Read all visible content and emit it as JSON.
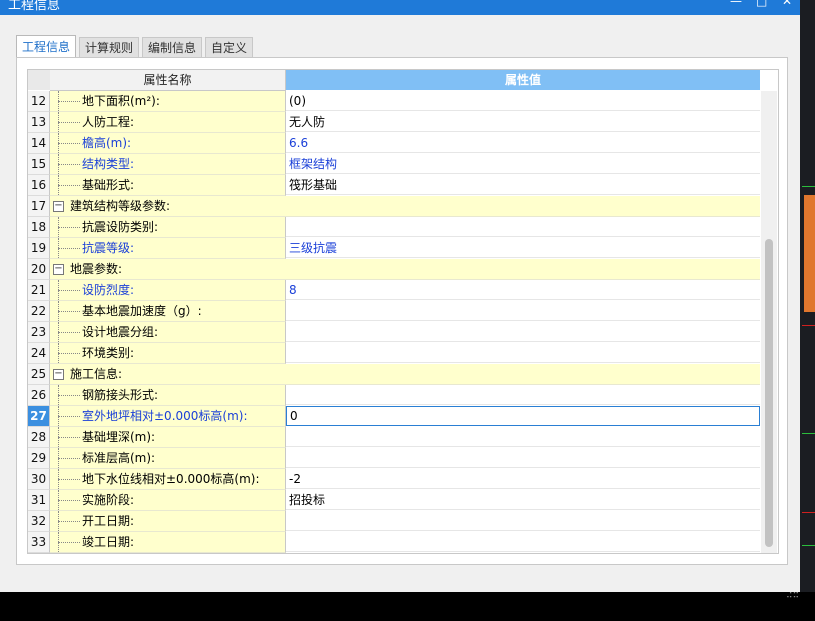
{
  "window": {
    "title": "工程信息",
    "minimize": "—",
    "maximize": "□",
    "close": "✕"
  },
  "tabs": [
    {
      "label": "工程信息",
      "active": true
    },
    {
      "label": "计算规则",
      "active": false
    },
    {
      "label": "编制信息",
      "active": false
    },
    {
      "label": "自定义",
      "active": false
    }
  ],
  "grid": {
    "headers": {
      "name": "属性名称",
      "value": "属性值"
    },
    "selected_row": "27",
    "rows": [
      {
        "num": "12",
        "name": "地下面积(m²):",
        "value": "(0)",
        "blue": false,
        "group": false
      },
      {
        "num": "13",
        "name": "人防工程:",
        "value": "无人防",
        "blue": false,
        "group": false
      },
      {
        "num": "14",
        "name": "檐高(m):",
        "value": "6.6",
        "blue": true,
        "group": false
      },
      {
        "num": "15",
        "name": "结构类型:",
        "value": "框架结构",
        "blue": true,
        "group": false
      },
      {
        "num": "16",
        "name": "基础形式:",
        "value": "筏形基础",
        "blue": false,
        "group": false
      },
      {
        "num": "17",
        "name": "建筑结构等级参数:",
        "value": "",
        "blue": false,
        "group": true
      },
      {
        "num": "18",
        "name": "抗震设防类别:",
        "value": "",
        "blue": false,
        "group": false
      },
      {
        "num": "19",
        "name": "抗震等级:",
        "value": "三级抗震",
        "blue": true,
        "group": false
      },
      {
        "num": "20",
        "name": "地震参数:",
        "value": "",
        "blue": false,
        "group": true
      },
      {
        "num": "21",
        "name": "设防烈度:",
        "value": "8",
        "blue": true,
        "group": false
      },
      {
        "num": "22",
        "name": "基本地震加速度（g）:",
        "value": "",
        "blue": false,
        "group": false
      },
      {
        "num": "23",
        "name": "设计地震分组:",
        "value": "",
        "blue": false,
        "group": false
      },
      {
        "num": "24",
        "name": "环境类别:",
        "value": "",
        "blue": false,
        "group": false
      },
      {
        "num": "25",
        "name": "施工信息:",
        "value": "",
        "blue": false,
        "group": true
      },
      {
        "num": "26",
        "name": "钢筋接头形式:",
        "value": "",
        "blue": false,
        "group": false
      },
      {
        "num": "27",
        "name": "室外地坪相对±0.000标高(m):",
        "value": "0",
        "blue": true,
        "group": false
      },
      {
        "num": "28",
        "name": "基础埋深(m):",
        "value": "",
        "blue": false,
        "group": false
      },
      {
        "num": "29",
        "name": "标准层高(m):",
        "value": "",
        "blue": false,
        "group": false
      },
      {
        "num": "30",
        "name": "地下水位线相对±0.000标高(m):",
        "value": "-2",
        "blue": false,
        "group": false
      },
      {
        "num": "31",
        "name": "实施阶段:",
        "value": "招投标",
        "blue": false,
        "group": false
      },
      {
        "num": "32",
        "name": "开工日期:",
        "value": "",
        "blue": false,
        "group": false
      },
      {
        "num": "33",
        "name": "竣工日期:",
        "value": "",
        "blue": false,
        "group": false
      }
    ]
  },
  "colors": {
    "accent": "#1f7ad8",
    "name_cell_bg": "#ffffcd",
    "value_header_bg": "#80bff5",
    "blue_text": "#1a3fd8"
  }
}
